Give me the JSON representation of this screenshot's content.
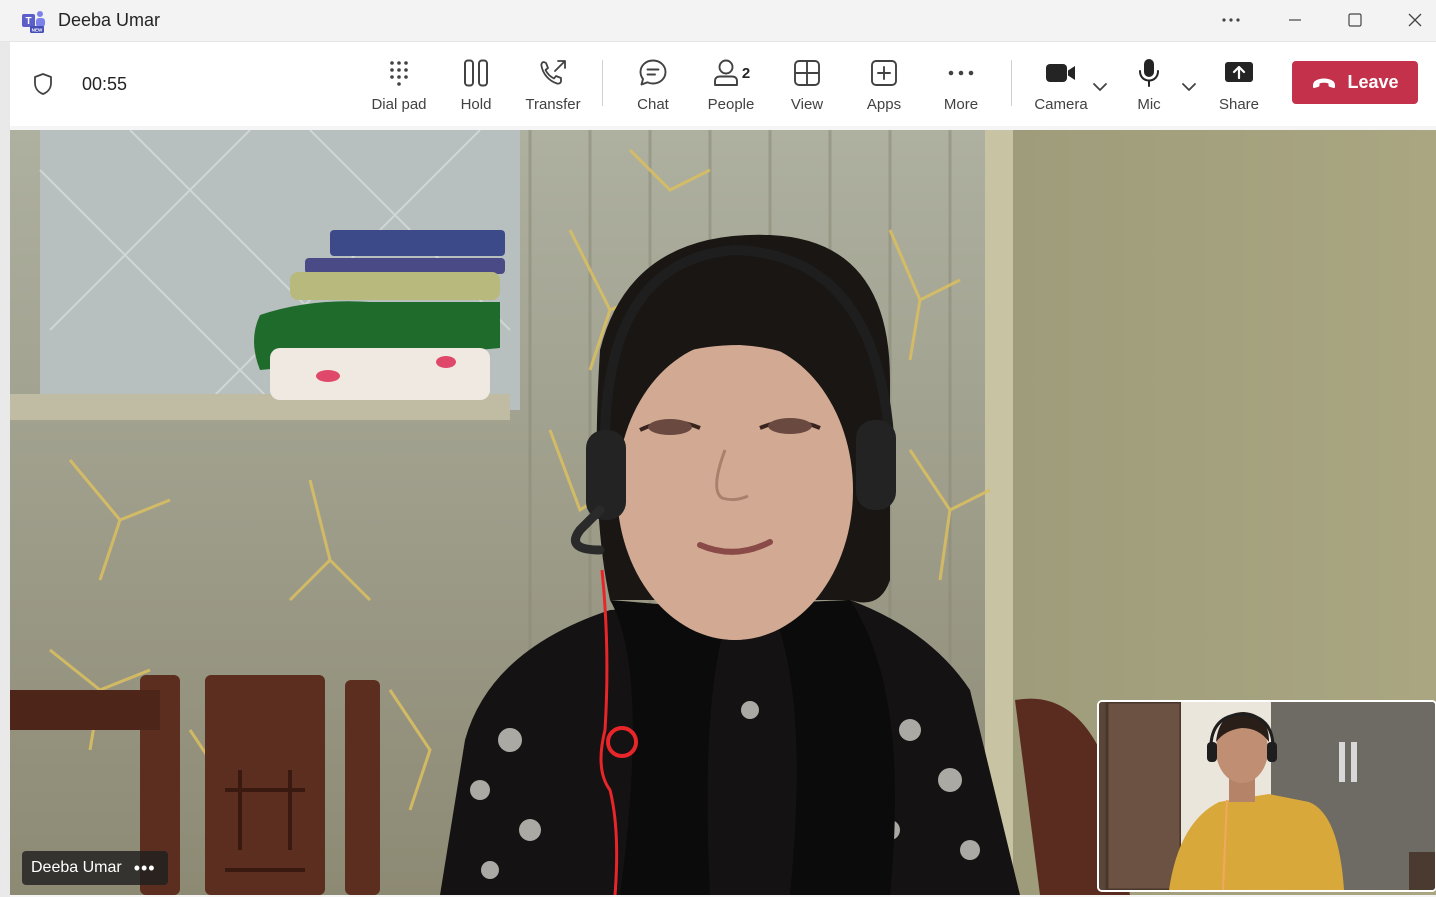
{
  "window": {
    "title": "Deeba Umar",
    "app_icon": "teams-new-icon"
  },
  "toolbar": {
    "timer": "00:55",
    "dial_pad_label": "Dial pad",
    "hold_label": "Hold",
    "transfer_label": "Transfer",
    "chat_label": "Chat",
    "people_label": "People",
    "people_count": "2",
    "view_label": "View",
    "apps_label": "Apps",
    "more_label": "More",
    "camera_label": "Camera",
    "mic_label": "Mic",
    "share_label": "Share",
    "leave_label": "Leave"
  },
  "stage": {
    "participant_name": "Deeba Umar",
    "more_options": "•••"
  },
  "colors": {
    "leave_red": "#c4314b",
    "toolbar_bg": "#ffffff",
    "titlebar_bg": "#f3f3f3",
    "teams_purple": "#5b5fc7"
  }
}
